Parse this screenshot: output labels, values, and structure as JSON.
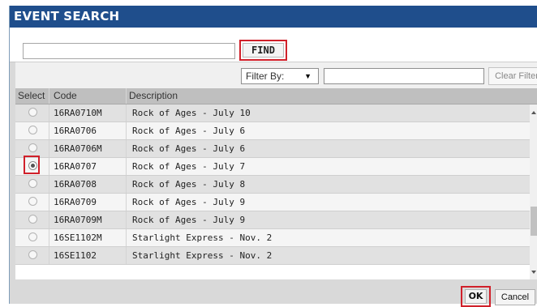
{
  "dialog": {
    "title": "EVENT SEARCH"
  },
  "search": {
    "value": "",
    "find_label": "FIND"
  },
  "filter": {
    "label": "Filter By:",
    "arrow": "▼",
    "value": "",
    "clear_label": "Clear Filter"
  },
  "grid": {
    "columns": [
      "Select",
      "Code",
      "Description"
    ],
    "rows": [
      {
        "code": "16RA0710M",
        "description": "Rock of Ages - July 10",
        "selected": false
      },
      {
        "code": "16RA0706",
        "description": "Rock of Ages - July 6",
        "selected": false
      },
      {
        "code": "16RA0706M",
        "description": "Rock of Ages - July 6",
        "selected": false
      },
      {
        "code": "16RA0707",
        "description": "Rock of Ages - July 7",
        "selected": true
      },
      {
        "code": "16RA0708",
        "description": "Rock of Ages - July 8",
        "selected": false
      },
      {
        "code": "16RA0709",
        "description": "Rock of Ages - July 9",
        "selected": false
      },
      {
        "code": "16RA0709M",
        "description": "Rock of Ages - July 9",
        "selected": false
      },
      {
        "code": "16SE1102M",
        "description": "Starlight Express - Nov. 2",
        "selected": false
      },
      {
        "code": "16SE1102",
        "description": "Starlight Express - Nov. 2",
        "selected": false
      }
    ]
  },
  "footer": {
    "ok_label": "OK",
    "cancel_label": "Cancel"
  },
  "colors": {
    "title_bar": "#1f4e8c",
    "highlight": "#d0202a"
  }
}
